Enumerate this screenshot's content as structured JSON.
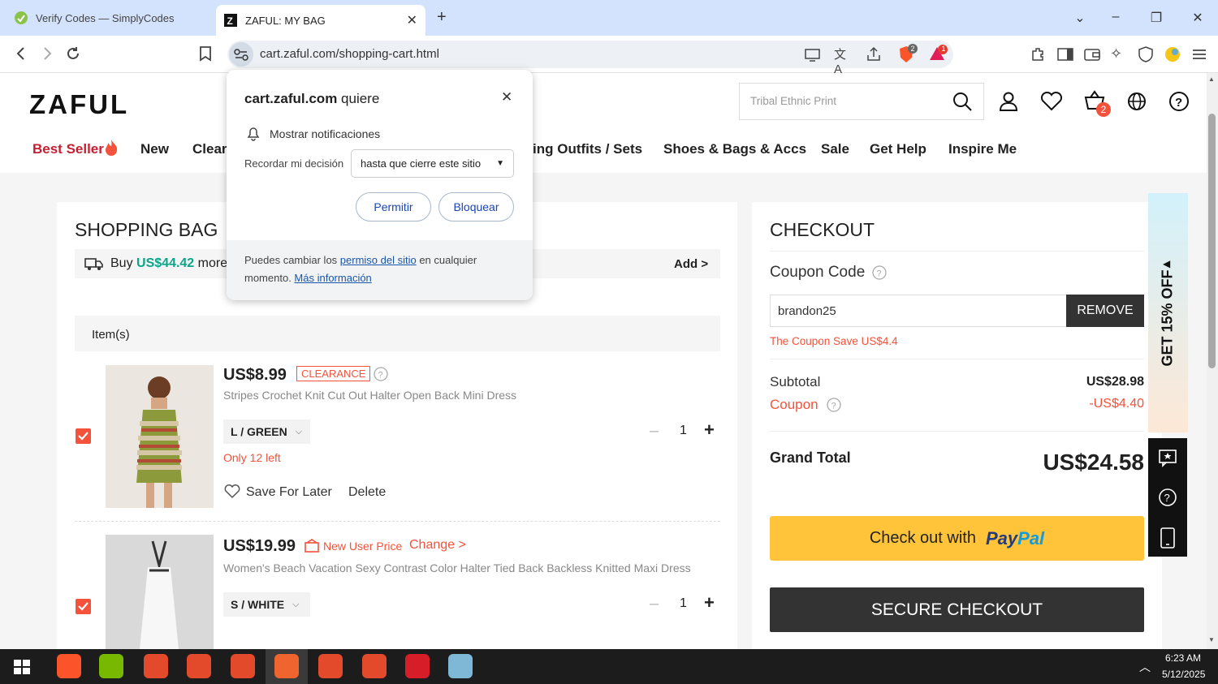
{
  "browser": {
    "tabs": [
      {
        "title": "Verify Codes — SimplyCodes",
        "active": false
      },
      {
        "title": "ZAFUL: MY BAG",
        "active": true
      }
    ],
    "url": "cart.zaful.com/shopping-cart.html",
    "shield_badge": "2",
    "alert_badge": "1"
  },
  "site": {
    "logo": "ZAFUL",
    "search_placeholder": "Tribal Ethnic Print",
    "cart_count": "2",
    "nav": [
      "Best Seller",
      "New",
      "Clear",
      "ing Outfits / Sets",
      "Shoes & Bags & Accs",
      "Sale",
      "Get Help",
      "Inspire Me"
    ]
  },
  "popup": {
    "title_host": "cart.zaful.com",
    "title_suffix": " quiere",
    "permission": "Mostrar notificaciones",
    "remember_label": "Recordar mi decisión",
    "remember_value": "hasta que cierre este sitio",
    "allow": "Permitir",
    "block": "Bloquear",
    "footer_1": "Puedes cambiar los ",
    "footer_link1": "permiso del sitio",
    "footer_2": " en cualquier",
    "footer_3": "momento. ",
    "footer_link2": "Más información"
  },
  "bag": {
    "title": "SHOPPING BAG",
    "promo_prefix": "Buy ",
    "promo_amount": "US$44.42",
    "promo_suffix": " more",
    "promo_add": "Add >",
    "items_header": "Item(s)",
    "items": [
      {
        "price": "US$8.99",
        "tag": "CLEARANCE",
        "name": "Stripes Crochet Knit Cut Out Halter Open Back Mini Dress",
        "variant": "L / GREEN",
        "stock": "Only 12 left",
        "qty": "1",
        "save": "Save For Later",
        "delete": "Delete"
      },
      {
        "price": "US$19.99",
        "tag": "New User Price",
        "change": "Change >",
        "name": "Women's Beach Vacation Sexy Contrast Color Halter Tied Back Backless Knitted Maxi Dress",
        "variant": "S / WHITE",
        "qty": "1"
      }
    ]
  },
  "checkout": {
    "title": "CHECKOUT",
    "coupon_label": "Coupon Code",
    "coupon_value": "brandon25",
    "remove": "REMOVE",
    "coupon_msg": "The Coupon Save US$4.4",
    "subtotal_label": "Subtotal",
    "subtotal": "US$28.98",
    "coupon_line_label": "Coupon",
    "coupon_line": "-US$4.40",
    "grand_label": "Grand Total",
    "grand": "US$24.58",
    "paypal_prefix": "Check out with",
    "paypal_pay": "Pay",
    "paypal_pal": "Pal",
    "secure": "SECURE CHECKOUT"
  },
  "float_promo": "GET 15% OFF",
  "taskbar": {
    "time": "6:23 AM",
    "date": "5/12/2025"
  }
}
